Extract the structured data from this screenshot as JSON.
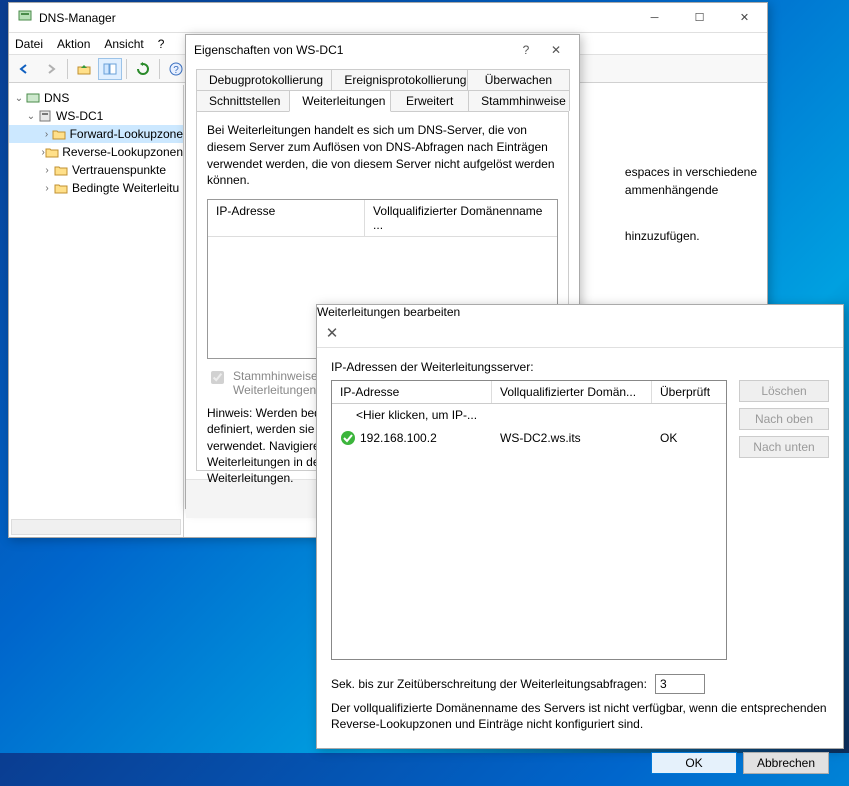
{
  "mainWindow": {
    "title": "DNS-Manager",
    "menu": {
      "datei": "Datei",
      "aktion": "Aktion",
      "ansicht": "Ansicht",
      "help": "?"
    },
    "tree": {
      "root": "DNS",
      "server": "WS-DC1",
      "nodes": {
        "fwd": "Forward-Lookupzone",
        "rev": "Reverse-Lookupzonen",
        "trust": "Vertrauenspunkte",
        "cond": "Bedingte Weiterleitu"
      }
    },
    "content": {
      "line1": "espaces in verschiedene",
      "line2": "ammenhängende",
      "line3": "hinzuzufügen."
    }
  },
  "propDialog": {
    "title": "Eigenschaften von WS-DC1",
    "help": "?",
    "tabsRow1": {
      "t1": "Debugprotokollierung",
      "t2": "Ereignisprotokollierung",
      "t3": "Überwachen"
    },
    "tabsRow2": {
      "t1": "Schnittstellen",
      "t2": "Weiterleitungen",
      "t3": "Erweitert",
      "t4": "Stammhinweise"
    },
    "description": "Bei Weiterleitungen handelt es sich um DNS-Server, die von diesem Server zum Auflösen von DNS-Abfragen nach Einträgen verwendet werden, die von diesem Server nicht aufgelöst werden können.",
    "cols": {
      "ip": "IP-Adresse",
      "fqdn": "Vollqualifizierter Domänenname ..."
    },
    "checkbox": "Stammhinweise ver\nWeiterleitungen ver",
    "hint": "Hinweis: Werden bedin\ndefiniert, werden sie a\nverwendet. Navigieren\nWeiterleitungen in der \nWeiterleitungen.",
    "buttons": {
      "ok": "OK"
    }
  },
  "editDialog": {
    "title": "Weiterleitungen bearbeiten",
    "listLabel": "IP-Adressen der Weiterleitungsserver:",
    "cols": {
      "ip": "IP-Adresse",
      "fqdn": "Vollqualifizierter Domän...",
      "verified": "Überprüft"
    },
    "placeholder": "<Hier klicken, um IP-...",
    "row1": {
      "ip": "192.168.100.2",
      "fqdn": "WS-DC2.ws.its",
      "verified": "OK"
    },
    "sideButtons": {
      "delete": "Löschen",
      "up": "Nach oben",
      "down": "Nach unten"
    },
    "timeoutLabel": "Sek. bis zur Zeitüberschreitung der Weiterleitungsabfragen:",
    "timeoutValue": "3",
    "note": "Der vollqualifizierte Domänenname des Servers ist nicht verfügbar, wenn die entsprechenden Reverse-Lookupzonen und Einträge nicht konfiguriert sind.",
    "buttons": {
      "ok": "OK",
      "cancel": "Abbrechen"
    }
  }
}
